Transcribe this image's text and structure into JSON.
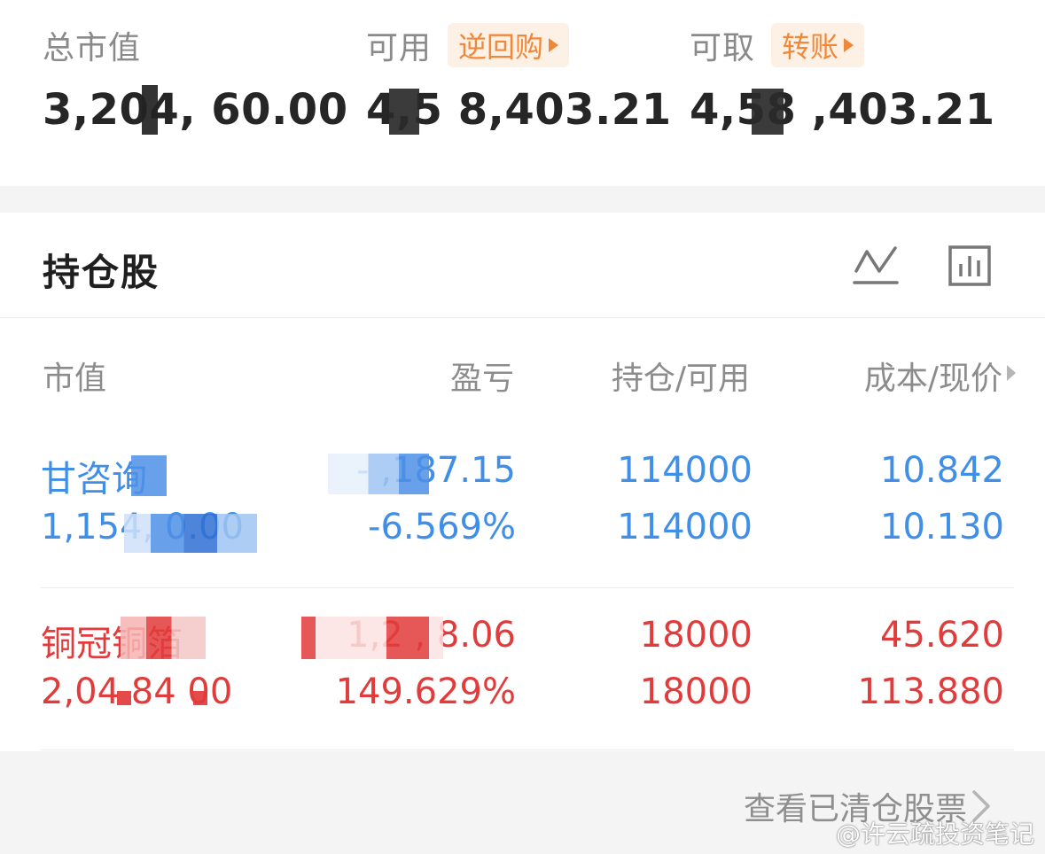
{
  "summary": {
    "total_market_value": {
      "label": "总市值",
      "value": "3,204,  60.00"
    },
    "available": {
      "label": "可用",
      "action_label": "逆回购",
      "value": "4,5  8,403.21"
    },
    "withdrawable": {
      "label": "可取",
      "action_label": "转账",
      "value": "4,58  ,403.21"
    }
  },
  "holdings": {
    "title": "持仓股",
    "icons": {
      "trend": "line-chart-icon",
      "bars": "bar-chart-icon"
    },
    "columns": {
      "market_value": "市值",
      "profit_loss": "盈亏",
      "position": "持仓/可用",
      "cost_price": "成本/现价"
    },
    "rows": [
      {
        "name": "甘咨询",
        "market_value": "1,154,  0.00",
        "profit_loss": "-  ,187.15",
        "profit_loss_pct": "-6.569%",
        "position": "114000",
        "available": "114000",
        "cost": "10.842",
        "price": "10.130",
        "color": "#3f8ee8"
      },
      {
        "name": "铜冠铜箔",
        "market_value": "2,04  84  00",
        "profit_loss": "1,2   ,  8.06",
        "profit_loss_pct": "149.629%",
        "position": "18000",
        "available": "18000",
        "cost": "45.620",
        "price": "113.880",
        "color": "#e23b3b"
      }
    ]
  },
  "footer": {
    "cleared_link": "查看已清仓股票",
    "watermark": "@许云疏投资笔记"
  },
  "colors": {
    "accent_orange": "#f0883a",
    "profit_red": "#e23b3b",
    "loss_blue": "#3f8ee8"
  }
}
